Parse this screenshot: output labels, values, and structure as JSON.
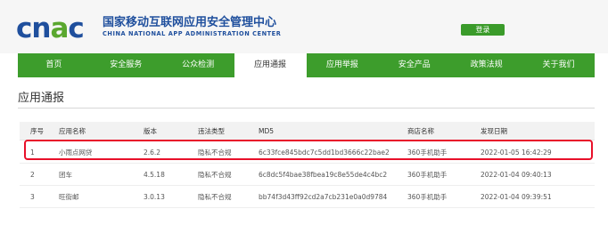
{
  "header": {
    "logo_text_c": "cn",
    "logo_text_a": "a",
    "logo_text_c2": "c",
    "title": "国家移动互联网应用安全管理中心",
    "subtitle": "CHINA NATIONAL APP ADMINISTRATION CENTER",
    "login_label": "登录"
  },
  "nav": {
    "items": [
      {
        "label": "首页"
      },
      {
        "label": "安全服务"
      },
      {
        "label": "公众检测"
      },
      {
        "label": "应用通报",
        "active": true
      },
      {
        "label": "应用举报"
      },
      {
        "label": "安全产品"
      },
      {
        "label": "政策法规"
      },
      {
        "label": "关于我们"
      }
    ]
  },
  "page": {
    "title": "应用通报"
  },
  "table": {
    "headers": [
      "序号",
      "应用名称",
      "版本",
      "违法类型",
      "MD5",
      "商店名称",
      "发现日期"
    ],
    "rows": [
      [
        "1",
        "小雨点网贷",
        "2.6.2",
        "隐私不合规",
        "6c33fce845bdc7c5dd1bd3666c22bae2",
        "360手机助手",
        "2022-01-05 16:42:29"
      ],
      [
        "2",
        "团车",
        "4.5.18",
        "隐私不合规",
        "6c8dc5f4bae38fbea19c8e55de4c4bc2",
        "360手机助手",
        "2022-01-04 09:40:13"
      ],
      [
        "3",
        "旺街邮",
        "3.0.13",
        "隐私不合规",
        "bb74f3d43ff92cd2a7cb231e0a0d9784",
        "360手机助手",
        "2022-01-04 09:39:51"
      ]
    ]
  },
  "colors": {
    "brand_blue": "#1f4f9d",
    "brand_green": "#3d9d2c",
    "highlight_red": "#e8102a"
  }
}
